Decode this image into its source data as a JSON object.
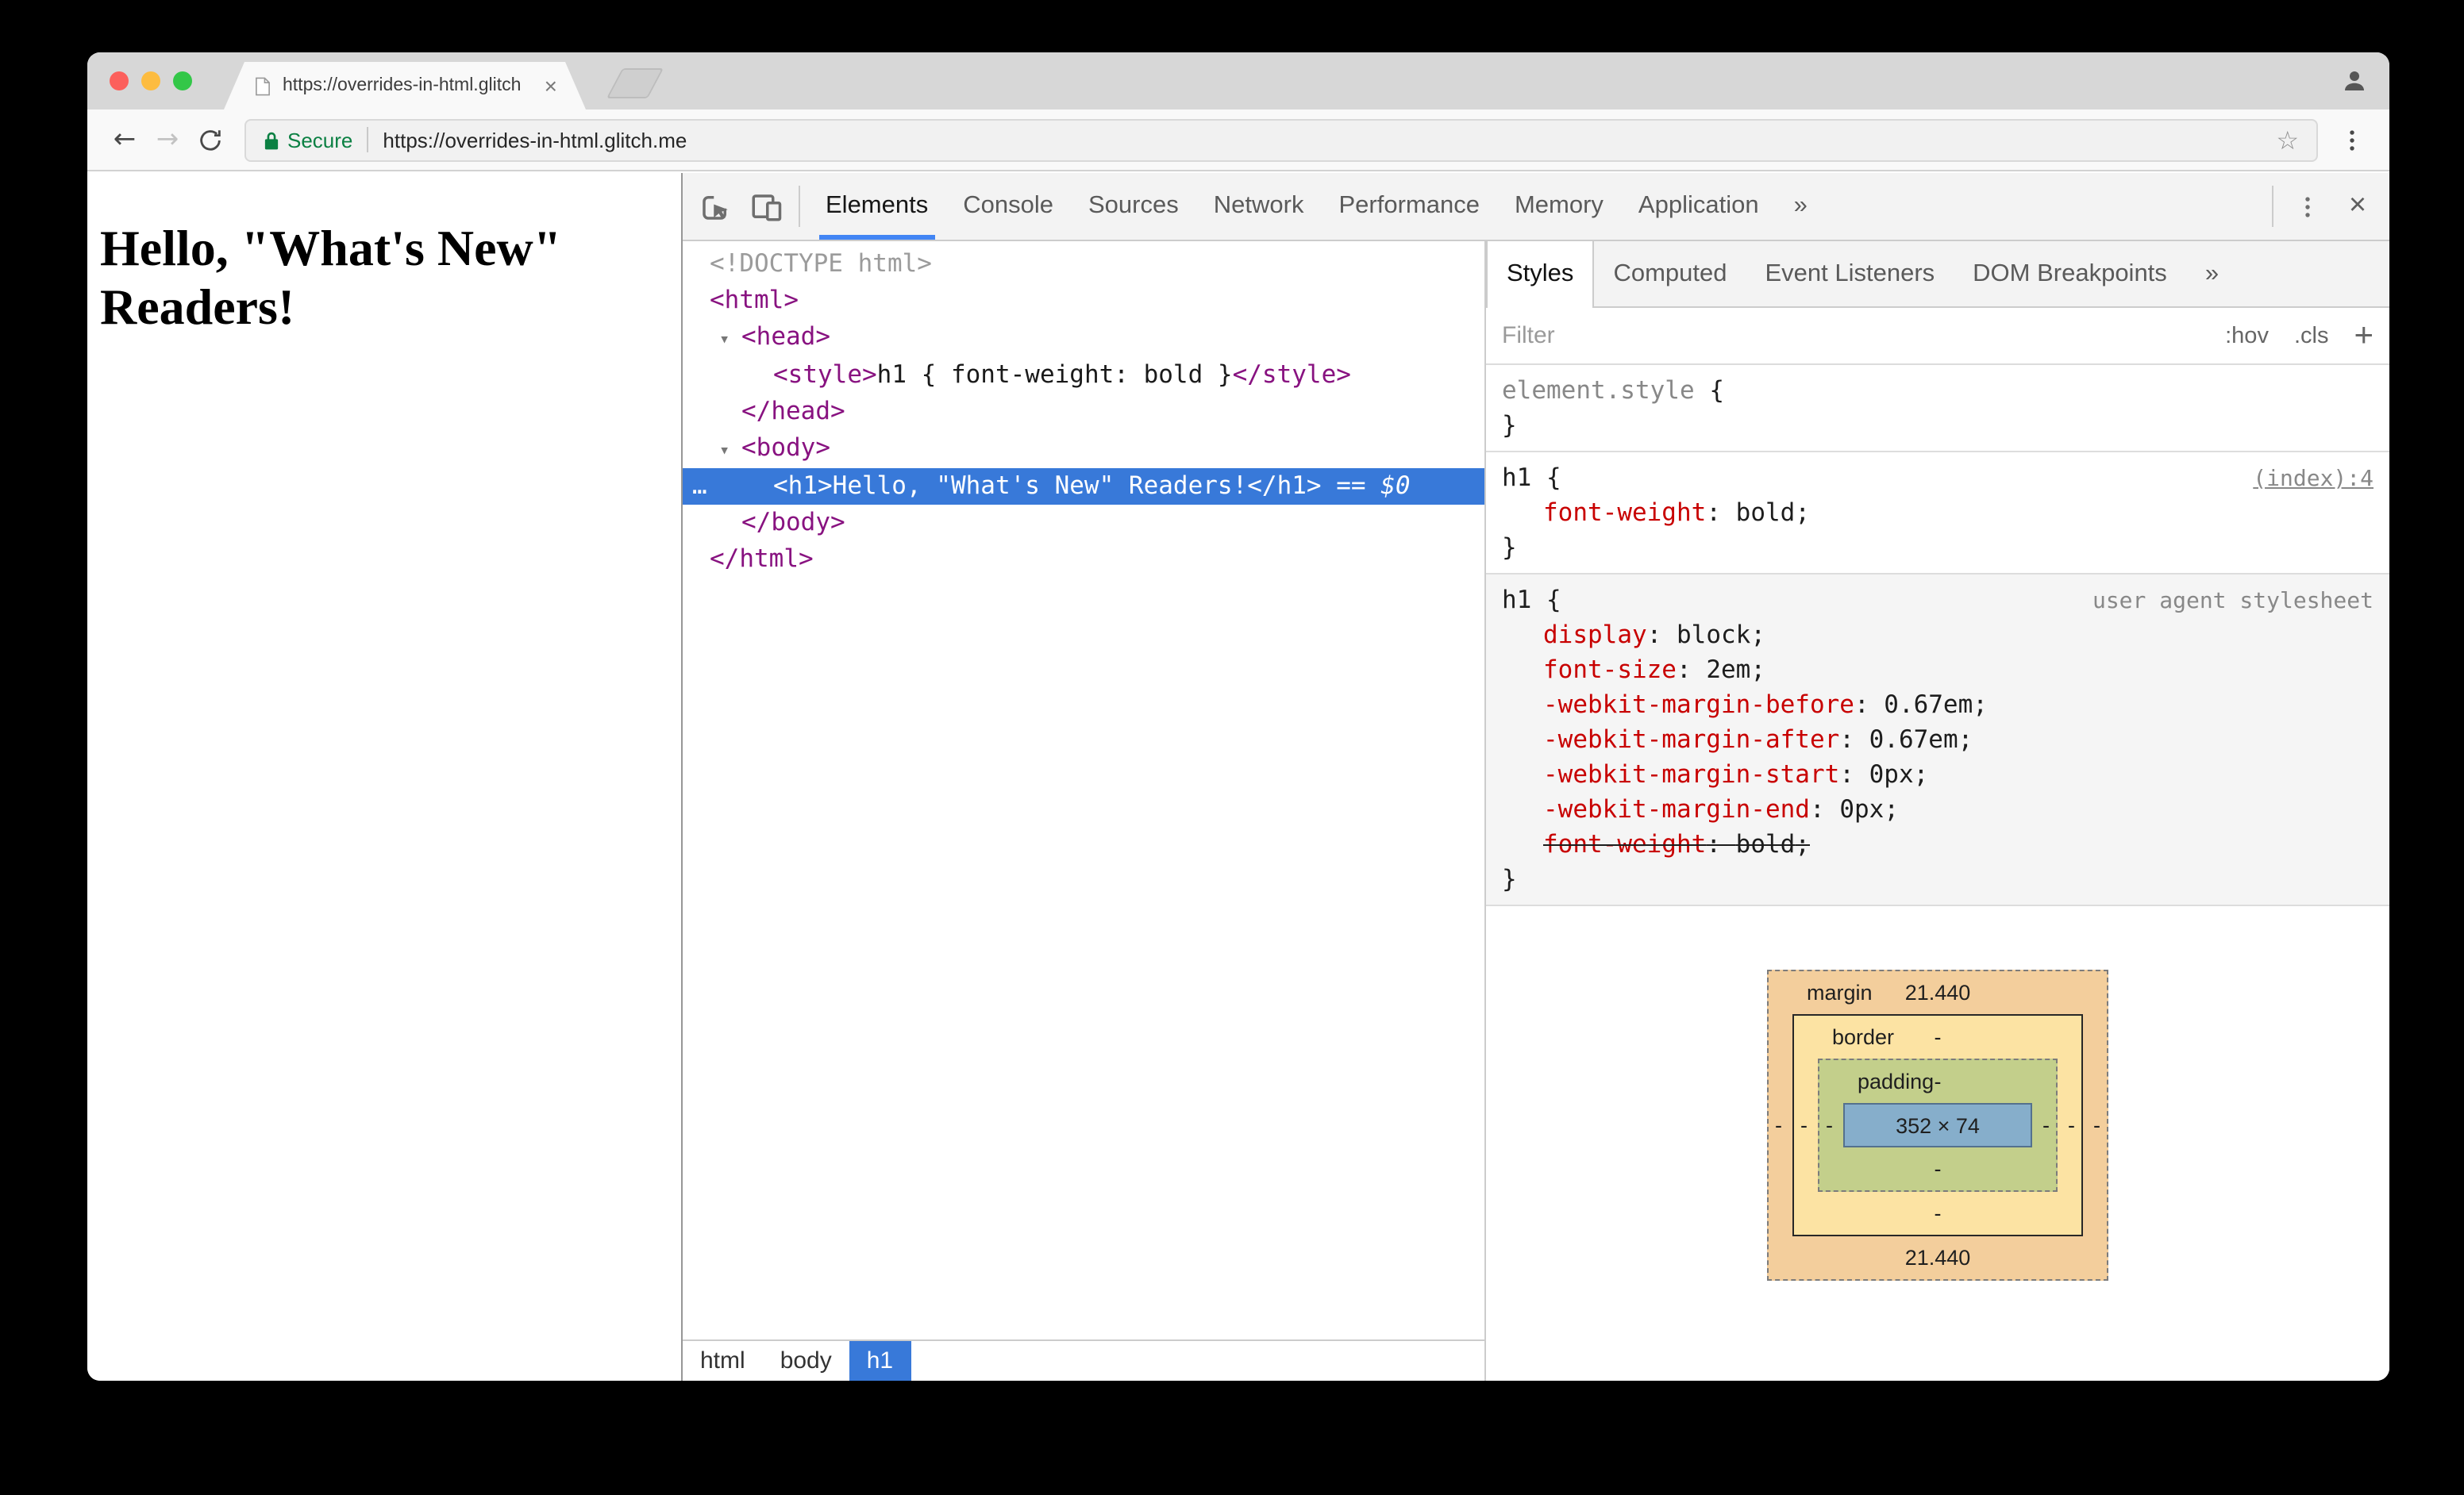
{
  "colors": {
    "selection_blue": "#3879d9",
    "accent_blue": "#4285f4",
    "secure_green": "#0b8043",
    "tag_purple": "#881280",
    "property_red": "#c80000",
    "box_margin": "#f3ce9c",
    "box_border": "#fce3a3",
    "box_padding": "#c3cf8b",
    "box_content": "#86aecb"
  },
  "icons": {
    "back": "←",
    "forward": "→",
    "star": "☆",
    "close": "×",
    "expand_arrow": "▾",
    "plus": "+"
  },
  "syntax": {
    "open_brace": " {",
    "close_brace": "}",
    "colon": ": ",
    "semicolon": ";"
  },
  "browser": {
    "tab": {
      "title": "https://overrides-in-html.glitch"
    },
    "address": {
      "secure_label": "Secure",
      "url": "https://overrides-in-html.glitch.me"
    }
  },
  "page": {
    "heading": "Hello, \"What's New\" Readers!"
  },
  "devtools": {
    "tabs": [
      {
        "name": "elements",
        "label": "Elements",
        "selected": true
      },
      {
        "name": "console",
        "label": "Console"
      },
      {
        "name": "sources",
        "label": "Sources"
      },
      {
        "name": "network",
        "label": "Network"
      },
      {
        "name": "performance",
        "label": "Performance"
      },
      {
        "name": "memory",
        "label": "Memory"
      },
      {
        "name": "application",
        "label": "Application"
      },
      {
        "name": "more",
        "label": "»"
      }
    ],
    "elements": {
      "tree": [
        {
          "indent": 0,
          "segments": [
            {
              "t": "<!DOCTYPE html>",
              "c": "comment"
            }
          ]
        },
        {
          "indent": 0,
          "segments": [
            {
              "t": "<html>",
              "c": "tag"
            }
          ]
        },
        {
          "indent": 1,
          "arrow": true,
          "segments": [
            {
              "t": "<head>",
              "c": "tag"
            }
          ]
        },
        {
          "indent": 2,
          "segments": [
            {
              "t": "<style>",
              "c": "tag"
            },
            {
              "t": "h1 { font-weight: bold }",
              "c": "text"
            },
            {
              "t": "</style>",
              "c": "tag"
            }
          ]
        },
        {
          "indent": 1,
          "segments": [
            {
              "t": "</head>",
              "c": "tag"
            }
          ]
        },
        {
          "indent": 1,
          "arrow": true,
          "segments": [
            {
              "t": "<body>",
              "c": "tag"
            }
          ]
        },
        {
          "indent": 2,
          "selected": true,
          "gutter": "…",
          "segments": [
            {
              "t": "<h1>",
              "c": "tag"
            },
            {
              "t": "Hello, \"What's New\" Readers!",
              "c": "text"
            },
            {
              "t": "</h1>",
              "c": "tag"
            },
            {
              "t": " == ",
              "c": "eq"
            },
            {
              "t": "$0",
              "c": "dollar"
            }
          ]
        },
        {
          "indent": 1,
          "segments": [
            {
              "t": "</body>",
              "c": "tag"
            }
          ]
        },
        {
          "indent": 0,
          "segments": [
            {
              "t": "</html>",
              "c": "tag"
            }
          ]
        }
      ],
      "breadcrumbs": [
        {
          "label": "html"
        },
        {
          "label": "body"
        },
        {
          "label": "h1",
          "selected": true
        }
      ]
    },
    "styles": {
      "tabs": [
        {
          "name": "styles",
          "label": "Styles",
          "selected": true
        },
        {
          "name": "computed",
          "label": "Computed"
        },
        {
          "name": "event-listeners",
          "label": "Event Listeners"
        },
        {
          "name": "dom-breakpoints",
          "label": "DOM Breakpoints"
        },
        {
          "name": "more",
          "label": "»"
        }
      ],
      "filter_placeholder": "Filter",
      "pseudo_button": ":hov",
      "class_button": ".cls",
      "rules": [
        {
          "selector": "element.style",
          "muted": true,
          "properties": []
        },
        {
          "selector": "h1",
          "link": "(index):4",
          "properties": [
            {
              "name": "font-weight",
              "value": "bold"
            }
          ]
        },
        {
          "selector": "h1",
          "origin": "user agent stylesheet",
          "properties": [
            {
              "name": "display",
              "value": "block"
            },
            {
              "name": "font-size",
              "value": "2em"
            },
            {
              "name": "-webkit-margin-before",
              "value": "0.67em"
            },
            {
              "name": "-webkit-margin-after",
              "value": "0.67em"
            },
            {
              "name": "-webkit-margin-start",
              "value": "0px"
            },
            {
              "name": "-webkit-margin-end",
              "value": "0px"
            },
            {
              "name": "font-weight",
              "value": "bold",
              "struck": true
            }
          ]
        }
      ],
      "box_model": {
        "margin_label": "margin",
        "margin_top": "21.440",
        "margin_bottom": "21.440",
        "margin_left": "-",
        "margin_right": "-",
        "border_label": "border",
        "border_top": "-",
        "border_bottom": "-",
        "border_left": "-",
        "border_right": "-",
        "padding_label": "padding",
        "padding_top": "-",
        "padding_bottom": "-",
        "padding_left": "-",
        "padding_right": "-",
        "content": "352 × 74"
      }
    }
  }
}
